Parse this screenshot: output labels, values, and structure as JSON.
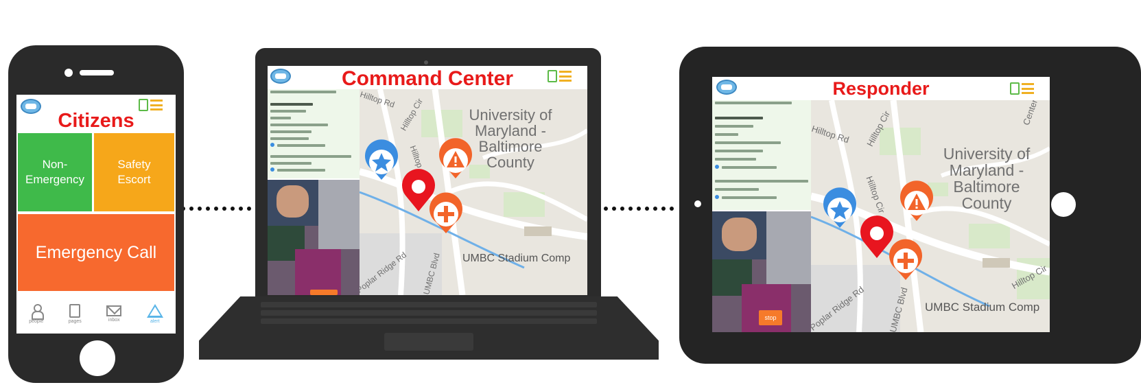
{
  "citizens": {
    "title": "Citizens",
    "tiles": {
      "non_emergency": "Non-\nEmergency",
      "safety_escort": "Safety\nEscort",
      "emergency_call": "Emergency Call"
    },
    "tabs": [
      {
        "label": "people",
        "icon": "person-icon"
      },
      {
        "label": "pages",
        "icon": "page-icon"
      },
      {
        "label": "inbox",
        "icon": "mail-icon"
      },
      {
        "label": "alert",
        "icon": "alert-icon"
      }
    ]
  },
  "command_center": {
    "title": "Command Center",
    "map_labels": {
      "campus": "University of\nMaryland -\nBaltimore\nCounty",
      "stadium": "UMBC Stadium Comp",
      "roads": [
        "Hilltop Rd",
        "Hilltop Cir",
        "Hilltop Cir",
        "Poplar Ridge Rd",
        "UMBC Blvd"
      ]
    }
  },
  "responder": {
    "title": "Responder",
    "stop_label": "stop",
    "map_labels": {
      "campus": "University of\nMaryland -\nBaltimore\nCounty",
      "stadium": "UMBC Stadium Comp",
      "roads": [
        "Hilltop Rd",
        "Hilltop Cir",
        "Hilltop Cir",
        "Hilltop Cir",
        "Poplar Ridge Rd",
        "UMBC Blvd",
        "Center"
      ]
    }
  },
  "colors": {
    "title_red": "#e81a1a",
    "non_emergency_green": "#3fba4a",
    "safety_escort_orange": "#f6a71a",
    "emergency_orange": "#f7692e",
    "marker_blue": "#3b8de0",
    "marker_red": "#e8151f",
    "marker_orange": "#f2642a"
  }
}
